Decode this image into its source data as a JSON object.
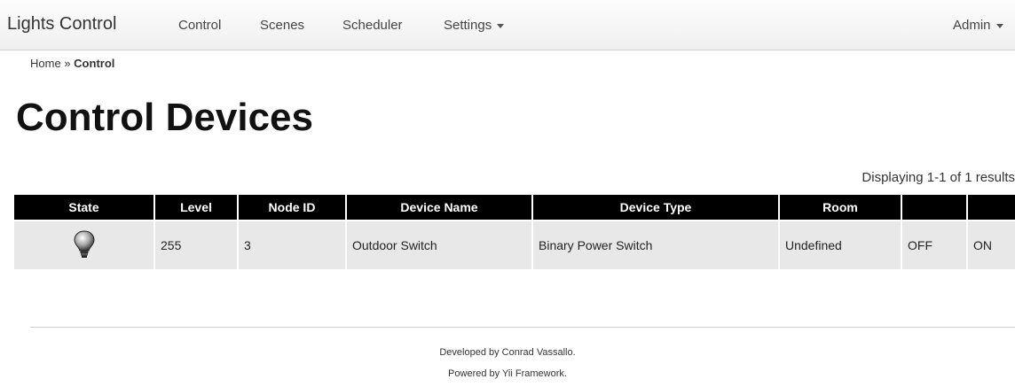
{
  "navbar": {
    "brand": "Lights Control",
    "items": [
      {
        "label": "Control"
      },
      {
        "label": "Scenes"
      },
      {
        "label": "Scheduler"
      },
      {
        "label": "Settings"
      }
    ],
    "user": "Admin"
  },
  "breadcrumb": {
    "home": "Home",
    "separator": "»",
    "current": "Control"
  },
  "page": {
    "title": "Control Devices",
    "summary": "Displaying 1-1 of 1 results"
  },
  "table": {
    "columns": [
      "State",
      "Level",
      "Node ID",
      "Device Name",
      "Device Type",
      "Room",
      "",
      ""
    ],
    "rows": [
      {
        "state_icon": "lightbulb-icon",
        "level": "255",
        "node_id": "3",
        "device_name": "Outdoor Switch",
        "device_type": "Binary Power Switch",
        "room": "Undefined",
        "off_label": "OFF",
        "on_label": "ON"
      }
    ]
  },
  "footer": {
    "line1": "Developed by Conrad Vassallo.",
    "line2": "Powered by Yii Framework."
  }
}
